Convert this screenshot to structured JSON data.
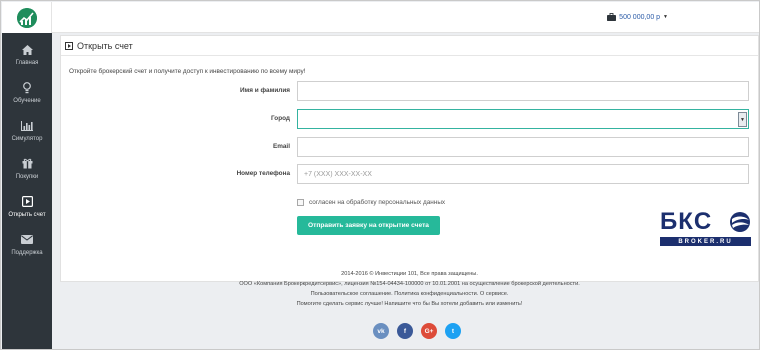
{
  "topbar": {
    "balance": "500 000,00 р"
  },
  "sidebar": {
    "items": [
      {
        "label": "Главная",
        "icon": "home-icon"
      },
      {
        "label": "Обучение",
        "icon": "lightbulb-icon"
      },
      {
        "label": "Симулятор",
        "icon": "bar-chart-icon"
      },
      {
        "label": "Покупки",
        "icon": "gift-icon"
      },
      {
        "label": "Открыть счет",
        "icon": "play-square-icon",
        "active": true
      },
      {
        "label": "Поддержка",
        "icon": "envelope-icon"
      }
    ]
  },
  "panel": {
    "title": "Открыть счет",
    "intro": "Откройте брокерский счет и получите доступ к инвестированию по всему миру!"
  },
  "form": {
    "name_label": "Имя и фамилия",
    "name_value": "",
    "city_label": "Город",
    "city_value": "",
    "email_label": "Email",
    "email_value": "",
    "phone_label": "Номер телефона",
    "phone_placeholder": "+7 (XXX) XXX-XX-XX",
    "consent_label": "согласен на обработку персональных данных",
    "submit_label": "Отправить заявку на открытие счета"
  },
  "brand": {
    "letters": [
      "Б",
      "К",
      "С"
    ],
    "subtitle": "BROKER.RU",
    "color": "#1c2f6e"
  },
  "footer": {
    "copyright": "2014-2016 © Инвестиции 101, Все права защищены.",
    "company": "ООО «Компания Брокеркредитсервис», лицензия №154-04434-100000 от 10.01.2001 на осуществление брокерской деятельности.",
    "link_agreement": "Пользовательское соглашение.",
    "link_privacy": "Политика конфиденциальности.",
    "link_about": "О сервисе.",
    "feedback": "Помогите сделать сервис лучше! Напишите что бы Вы хотели добавить или изменить!"
  },
  "socials": [
    {
      "label": "vk",
      "name": "vk-icon",
      "color": "#6a8fc0"
    },
    {
      "label": "f",
      "name": "facebook-icon",
      "color": "#3b5998"
    },
    {
      "label": "G+",
      "name": "google-plus-icon",
      "color": "#dd4b39"
    },
    {
      "label": "t",
      "name": "twitter-icon",
      "color": "#1da1f2"
    }
  ],
  "colors": {
    "sidebar": "#2e353b",
    "accent": "#26b99a",
    "link": "#2c5ca8"
  }
}
